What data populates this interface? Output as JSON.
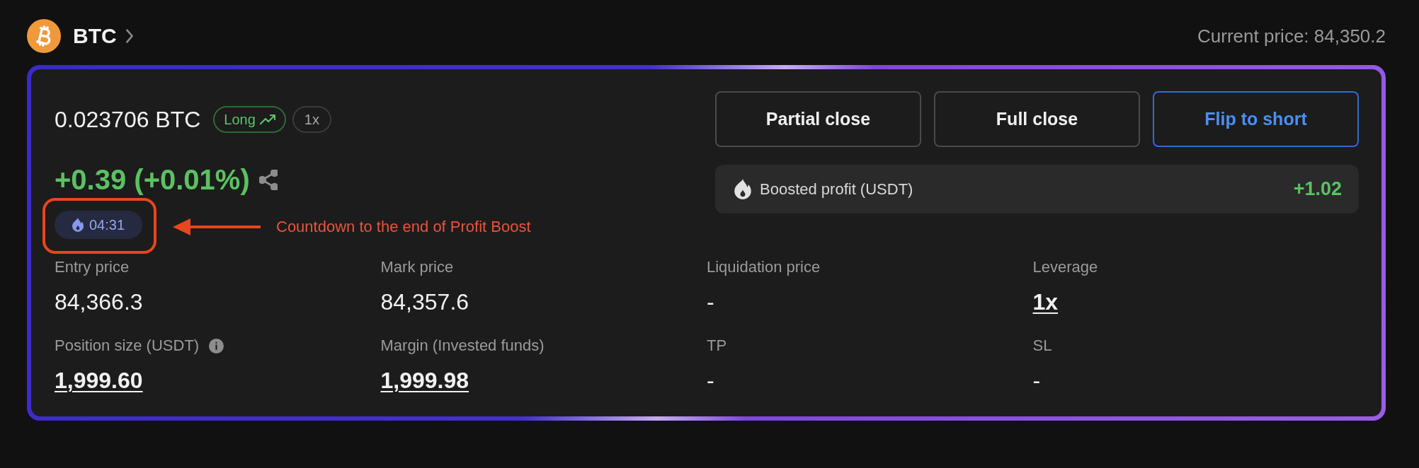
{
  "header": {
    "symbol": "BTC",
    "current_price": "Current price: 84,350.2"
  },
  "position": {
    "size": "0.023706 BTC",
    "side_badge": {
      "label": "Long",
      "kind": "long"
    },
    "leverage_badge": "1x",
    "pnl": "+0.39 (+0.01%)",
    "countdown": "04:31"
  },
  "actions": [
    {
      "label": "Partial close",
      "kind": "neutral"
    },
    {
      "label": "Full close",
      "kind": "neutral"
    },
    {
      "label": "Flip to short",
      "kind": "primary"
    }
  ],
  "boosted_profit": {
    "label": "Boosted profit (USDT)",
    "value": "+1.02"
  },
  "stats": [
    {
      "label": "Entry price",
      "value": "84,366.3",
      "kind": "plain"
    },
    {
      "label": "Mark price",
      "value": "84,357.6",
      "kind": "plain"
    },
    {
      "label": "Liquidation price",
      "value": "-",
      "kind": "plain"
    },
    {
      "label": "Leverage",
      "value": "1x",
      "kind": "link"
    },
    {
      "label": "Position size (USDT)",
      "value": "1,999.60",
      "kind": "link",
      "info": true
    },
    {
      "label": "Margin (Invested funds)",
      "value": "1,999.98",
      "kind": "link"
    },
    {
      "label": "TP",
      "value": "-",
      "kind": "plain"
    },
    {
      "label": "SL",
      "value": "-",
      "kind": "plain"
    }
  ],
  "annotation": {
    "text": "Countdown to the end of Profit Boost"
  }
}
